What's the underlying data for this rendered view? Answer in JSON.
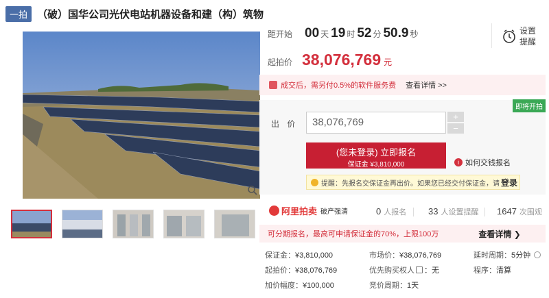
{
  "header": {
    "tag": "一拍",
    "title": "（破）国华公司光伏电站机器设备和建（构）筑物"
  },
  "countdown": {
    "label": "距开始",
    "days": "00",
    "days_unit": "天",
    "hours": "19",
    "hours_unit": "时",
    "minutes": "52",
    "minutes_unit": "分",
    "seconds": "50.9",
    "seconds_unit": "秒"
  },
  "remind": {
    "line1": "设置",
    "line2": "提醒",
    "icon": "alarm-clock-icon"
  },
  "start_price": {
    "label": "起拍价",
    "value": "38,076,769",
    "unit": "元"
  },
  "fee_notice": {
    "text": "成交后，需另付0.5%的软件服务费",
    "link": "查看详情 >>"
  },
  "bid": {
    "status_badge": "即将开拍",
    "label": "出 价",
    "amount": "38,076,769",
    "increment": "+",
    "decrement": "−",
    "signup_main": "(您未登录) 立即报名",
    "signup_sub": "保证金 ¥3,810,000",
    "howto": "如何交钱报名",
    "tip_text": "提醒：先报名交保证金再出价。如果您已经交付保证金，请",
    "tip_link": "登录"
  },
  "brand": {
    "name": "阿里拍卖",
    "sub": "破产强清"
  },
  "stats": [
    {
      "num": "0",
      "label": "人报名"
    },
    {
      "num": "33",
      "label": "人设置提醒"
    },
    {
      "num": "1647",
      "label": "次围观"
    }
  ],
  "deposit_notice": {
    "text": "可分期报名，最高可申请保证金的70%，上限100万",
    "link": "查看详情 ❯"
  },
  "details": {
    "deposit_label": "保证金：",
    "deposit": "¥3,810,000",
    "market_label": "市场价：",
    "market": "¥38,076,769",
    "extend_label": "延时周期：",
    "extend": "5分钟",
    "start_label": "起拍价：",
    "start": "¥38,076,769",
    "priority_label": "优先购买权人",
    "priority": "：无",
    "procedure_label": "程序：",
    "procedure": "清算",
    "increment_label": "加价幅度：",
    "increment": "¥100,000",
    "cycle_label": "竞价周期：",
    "cycle": "1天"
  },
  "colors": {
    "accent": "#d32f3c",
    "tag": "#4a6ea8",
    "soon": "#3aa855"
  }
}
